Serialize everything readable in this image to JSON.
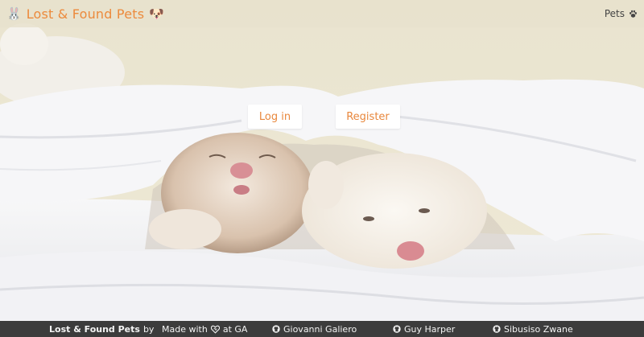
{
  "navbar": {
    "brand_icon": "🐰",
    "brand_title": "Lost & Found Pets",
    "brand_emoji": "🐶",
    "pets_label": "Pets",
    "pets_icon": "paw-icon"
  },
  "auth": {
    "login_label": "Log in",
    "register_label": "Register"
  },
  "footer": {
    "site_name": "Lost & Found Pets",
    "by": "by",
    "made_with": "Made with",
    "heart_icon": "heart-icon",
    "at_ga": "at GA",
    "authors": [
      "Giovanni Galiero",
      "Guy Harper",
      "Sibusiso Zwane"
    ]
  },
  "colors": {
    "accent": "#ec8a3c",
    "navbar_bg": "#e8e2cd",
    "footer_bg": "#3c3c3c"
  }
}
